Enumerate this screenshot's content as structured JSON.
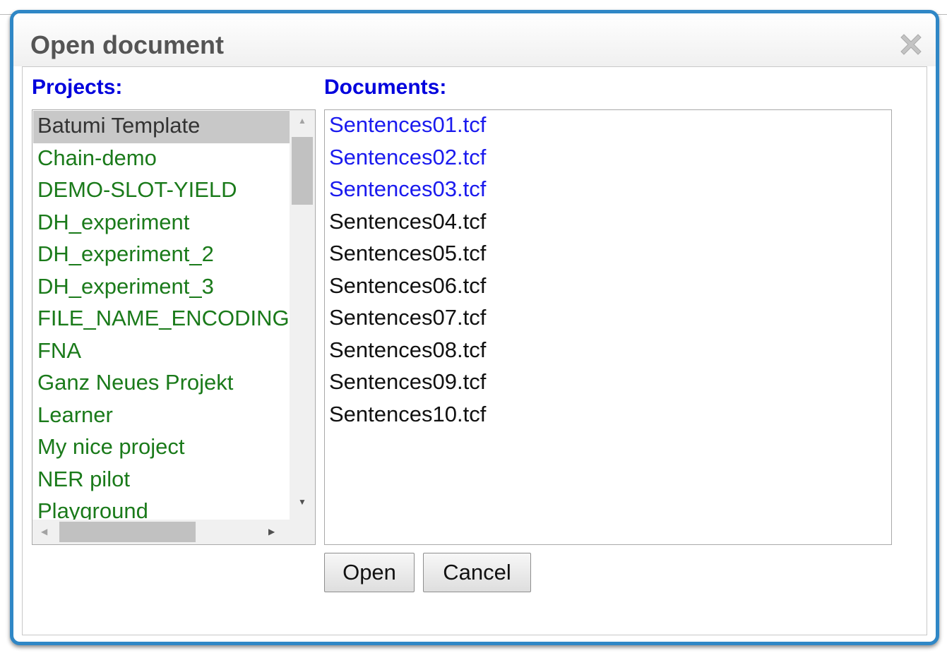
{
  "dialog": {
    "title": "Open document",
    "close_icon": "close-x-icon"
  },
  "projects": {
    "label": "Projects:",
    "selected": "Batumi Template",
    "items": [
      "Batumi Template",
      "Chain-demo",
      "DEMO-SLOT-YIELD",
      "DH_experiment",
      "DH_experiment_2",
      "DH_experiment_3",
      "FILE_NAME_ENCODING",
      "FNA",
      "Ganz Neues Projekt",
      "Learner",
      "My nice project",
      "NER pilot",
      "Playground"
    ]
  },
  "documents": {
    "label": "Documents:",
    "items": [
      {
        "name": "Sentences01.tcf",
        "color": "#1a1aee"
      },
      {
        "name": "Sentences02.tcf",
        "color": "#1a1aee"
      },
      {
        "name": "Sentences03.tcf",
        "color": "#1a1aee"
      },
      {
        "name": "Sentences04.tcf",
        "color": "#111111"
      },
      {
        "name": "Sentences05.tcf",
        "color": "#111111"
      },
      {
        "name": "Sentences06.tcf",
        "color": "#111111"
      },
      {
        "name": "Sentences07.tcf",
        "color": "#111111"
      },
      {
        "name": "Sentences08.tcf",
        "color": "#111111"
      },
      {
        "name": "Sentences09.tcf",
        "color": "#111111"
      },
      {
        "name": "Sentences10.tcf",
        "color": "#111111"
      }
    ]
  },
  "buttons": {
    "open": "Open",
    "cancel": "Cancel"
  },
  "colors": {
    "frame": "#2f87c6",
    "label": "#0000dd",
    "project_text": "#1a7a1a",
    "selection": "#c8c8c8"
  }
}
